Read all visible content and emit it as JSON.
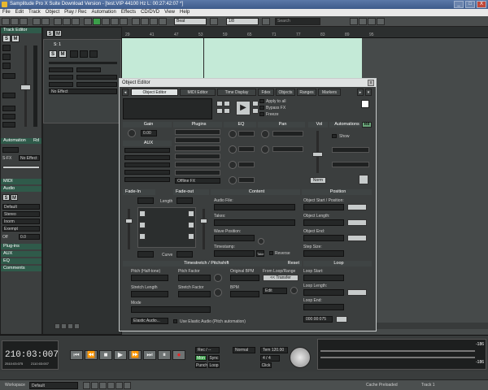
{
  "window": {
    "title": "Samplitude Pro X Suite Download Version - [test.VIP  44100 Hz L: 00:27:42:07 *]",
    "min": "_",
    "max": "□",
    "close": "X"
  },
  "menu": [
    "File",
    "Edit",
    "Track",
    "Object",
    "Play / Rec",
    "Automation",
    "Effects",
    "CD/DVD",
    "View",
    "Help"
  ],
  "toolbar": {
    "snap": "Beat",
    "grid": "1/8",
    "search": "Search"
  },
  "track_editor": {
    "title": "Track Editor",
    "s1": "S",
    "m1": "M",
    "s2": "S",
    "m2": "M",
    "track_name": "S: 1",
    "s3": "S",
    "m3": "M",
    "no_effect1": "No Effect",
    "no_effect2": "No Effect",
    "automation": "Automation",
    "rd": "Rd",
    "s_fx": "S-FX",
    "midi": "MIDI",
    "audio": "Audio",
    "plugins": "Plug-ins",
    "aux": "AUX",
    "eq": "EQ",
    "comments": "Comments",
    "s4": "S",
    "m4": "M",
    "default_val": "Default",
    "stereo": "Stereo",
    "i_norm": "Inorm",
    "exempt": "Exempt",
    "off": "Off",
    "zero": "0.0"
  },
  "ruler": {
    "marks": [
      "29",
      "41",
      "47",
      "53",
      "59",
      "65",
      "71",
      "77",
      "83",
      "89",
      "95"
    ]
  },
  "object_editor": {
    "title": "Object Editor",
    "tabs": [
      "Object Editor",
      "MIDI Editor",
      "Time Display",
      "Fdex",
      "Objects",
      "Ranges",
      "Markers"
    ],
    "apply_all": "Apply to all",
    "bypass_fx": "Bypass FX",
    "freeze": "Freeze",
    "cols": [
      "Gain",
      "Plugins",
      "EQ",
      "Pan",
      "Vol",
      "Automations"
    ],
    "gain_val": "0.00",
    "aux": "AUX",
    "offline_fx": "Offline FX",
    "show": "Show",
    "norm": "Norm",
    "rd": "Rd",
    "fade_in": "Fade-In",
    "fade_out": "Fade-out",
    "content": "Content",
    "position": "Position",
    "length": "Length",
    "curve": "Curve",
    "audio_file": "Audio File:",
    "takes": "Takes:",
    "wave_position": "Wave Position:",
    "timestamp": "Timestamp:",
    "reverse": "Reverse",
    "take_btn": "Take",
    "obj_start": "Object Start / Position:",
    "obj_length": "Object Length:",
    "obj_end": "Object End:",
    "step_size": "Step Size:",
    "timestretch": "Timestretch / Pitchshift",
    "reset": "Reset",
    "loop": "Loop",
    "pitch": "Pitch (Half-tone)",
    "pitch_factor": "Pitch Factor",
    "original_bpm": "Original BPM",
    "from_loop": "From Loop/Range",
    "transfer": "<< Transfer",
    "stretch_length": "Stretch Length",
    "stretch_factor": "Stretch Factor",
    "bpm": "BPM",
    "edit": "Edit",
    "mode": "Mode",
    "loop_start": "Loop Start:",
    "loop_length": "Loop Length:",
    "loop_end": "Loop End:",
    "loop_time": "000:00:075",
    "elastic_audio": "Elastic Audio...",
    "use_elastic": "Use Elastic Audio (Pitch automation)"
  },
  "transport": {
    "time": "210:03:007",
    "time_small1": "2510:03:075",
    "time_small2": "2110:03:007",
    "normal": "Normal",
    "bpm": "Tem 120.00",
    "sig": "4 / 4",
    "rec_mode": "Rec / --",
    "mon": "Mon",
    "punch": "Punch",
    "loop": "Loop",
    "click": "Click",
    "sync": "Sync",
    "meter_l": "-186",
    "meter_r": "-186"
  },
  "statusbar": {
    "workspace_label": "Workspace",
    "workspace": "Default",
    "cache": "Cache Preloaded",
    "track": "Track 1"
  },
  "colors": {
    "accent": "#2f5a4a",
    "timeline": "#c4ead7"
  }
}
